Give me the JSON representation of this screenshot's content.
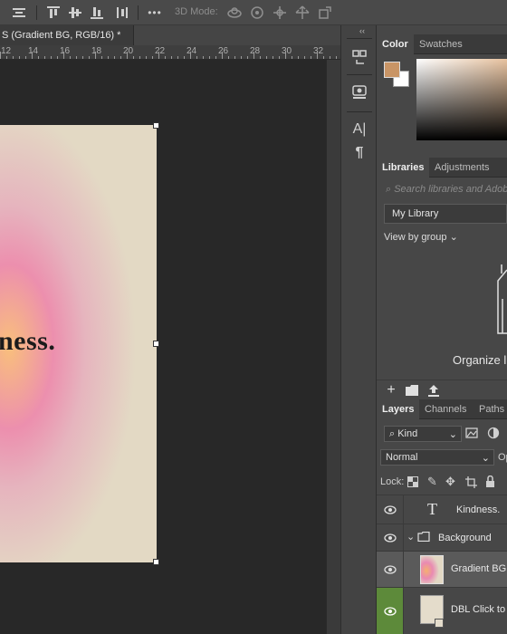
{
  "option_bar": {
    "mode_3d_label": "3D Mode:",
    "more_label": "•••",
    "icons": [
      "align-left-icon",
      "align-top-icon",
      "align-vcenter-icon",
      "align-bottom-icon",
      "distribute-icon",
      "more-icon",
      "orbit-3d-icon",
      "roll-3d-icon",
      "pan-3d-icon",
      "slide-3d-icon",
      "scale-3d-icon"
    ]
  },
  "document": {
    "tab_title": "S (Gradient BG, RGB/16) *",
    "ruler_ticks": [
      "12",
      "14",
      "16",
      "18",
      "20",
      "22",
      "24",
      "26",
      "28",
      "30",
      "32"
    ],
    "artboard_text": "ness."
  },
  "tool_strip": {
    "collapse_glyph": "‹‹",
    "character_glyph": "A|",
    "paragraph_glyph": "¶"
  },
  "color_panel": {
    "tabs": [
      "Color",
      "Swatches"
    ],
    "foreground_color": "#c99566",
    "background_color": "#ffffff"
  },
  "libraries_panel": {
    "tabs": [
      "Libraries",
      "Adjustments"
    ],
    "search_placeholder": "Search libraries and Adob",
    "library_name": "My Library",
    "view_by": "View by group",
    "organize_text": "Organize l"
  },
  "layers_panel": {
    "tabs": [
      "Layers",
      "Channels",
      "Paths"
    ],
    "filter_kind": "Kind",
    "blend_mode": "Normal",
    "opacity_label": "Op",
    "lock_label": "Lock:",
    "layers": [
      {
        "name": "Kindness.",
        "type": "text"
      },
      {
        "name": "Background",
        "type": "group"
      },
      {
        "name": "Gradient BG",
        "type": "image"
      },
      {
        "name": "DBL Click to C",
        "type": "smart-object"
      }
    ]
  },
  "colors": {
    "accent_green": "#5d8a3a",
    "selected_layer": "#5a5a5a"
  }
}
